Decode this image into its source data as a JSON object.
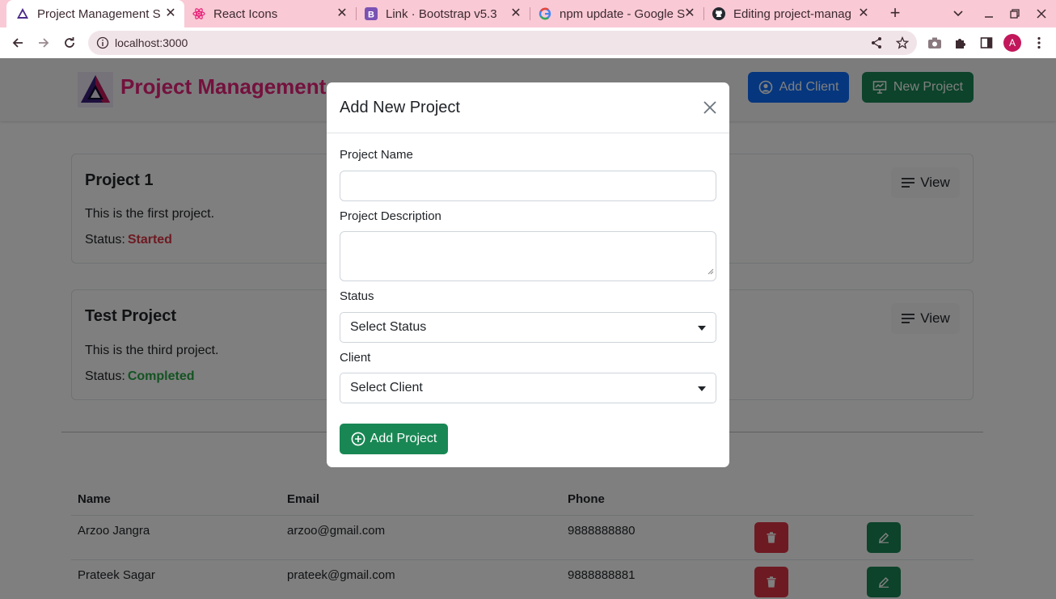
{
  "browser": {
    "tabs": [
      {
        "title": "Project Management S",
        "active": true
      },
      {
        "title": "React Icons",
        "active": false
      },
      {
        "title": "Link · Bootstrap v5.3",
        "active": false
      },
      {
        "title": "npm update - Google S",
        "active": false
      },
      {
        "title": "Editing project-manag",
        "active": false
      }
    ],
    "url": "localhost:3000",
    "profile_initial": "A"
  },
  "navbar": {
    "brand": "Project Management",
    "add_client_label": "Add Client",
    "new_project_label": "New Project"
  },
  "projects": [
    {
      "name": "Project 1",
      "description": "This is the first project.",
      "status_label": "Status:",
      "status": "Started",
      "status_color": "#dc3545"
    },
    {
      "name": "Test Project",
      "description": "This is the third project.",
      "status_label": "Status:",
      "status": "Completed",
      "status_color": "#28a745"
    }
  ],
  "view_label": "View",
  "clients_table": {
    "headers": [
      "Name",
      "Email",
      "Phone"
    ],
    "rows": [
      {
        "name": "Arzoo Jangra",
        "email": "arzoo@gmail.com",
        "phone": "9888888880"
      },
      {
        "name": "Prateek Sagar",
        "email": "prateek@gmail.com",
        "phone": "9888888881"
      }
    ]
  },
  "modal": {
    "title": "Add New Project",
    "name_label": "Project Name",
    "name_value": "",
    "description_label": "Project Description",
    "description_value": "",
    "status_label": "Status",
    "status_value": "Select Status",
    "client_label": "Client",
    "client_value": "Select Client",
    "submit_label": "Add Project"
  },
  "colors": {
    "brand": "#e8237a",
    "primary": "#0d6efd",
    "success": "#198754",
    "danger": "#dc3545",
    "tabbar": "#f9c9d5"
  }
}
